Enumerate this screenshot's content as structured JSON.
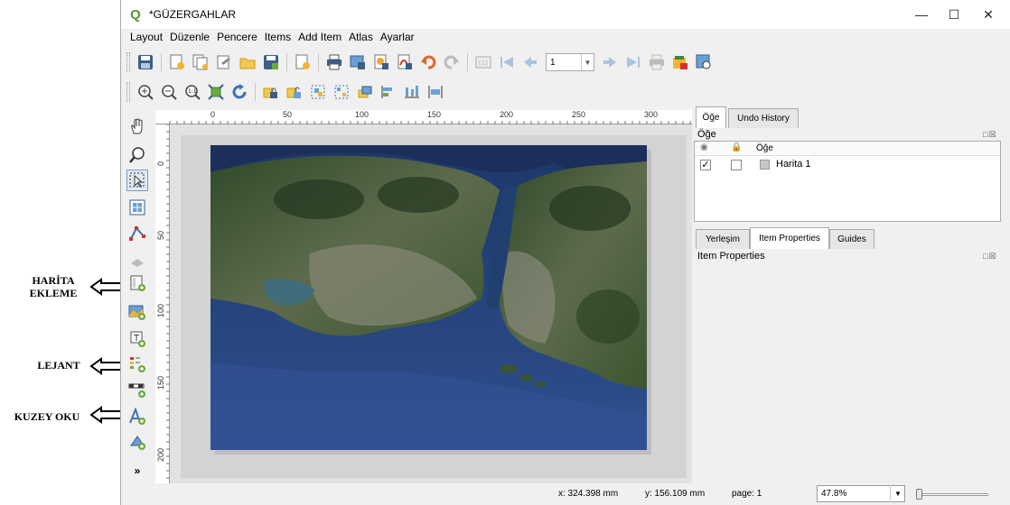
{
  "window": {
    "title": "*GÜZERGAHLAR"
  },
  "menu": [
    "Layout",
    "Düzenle",
    "Pencere",
    "Items",
    "Add Item",
    "Atlas",
    "Ayarlar"
  ],
  "toolbar": {
    "page_value": "1"
  },
  "annotations": {
    "harita_line1": "HARİTA",
    "harita_line2": "EKLEME",
    "lejant": "LEJANT",
    "kuzey": "KUZEY OKU"
  },
  "ruler": {
    "h_labels": [
      "0",
      "50",
      "100",
      "150",
      "200",
      "250",
      "300"
    ],
    "v_labels": [
      "0",
      "50",
      "100",
      "150",
      "200"
    ]
  },
  "panel": {
    "top_tabs": [
      "Öğe",
      "Undo History"
    ],
    "items_header": "Öğe",
    "list_column": "Öğe",
    "items": [
      {
        "name": "Harita 1",
        "visible": true,
        "locked": false
      }
    ],
    "bottom_tabs": [
      "Yerleşim",
      "Item Properties",
      "Guides"
    ],
    "props_header": "Item Properties"
  },
  "status": {
    "x": "x: 324.398 mm",
    "y": "y: 156.109 mm",
    "page": "page: 1",
    "zoom": "47.8%"
  }
}
